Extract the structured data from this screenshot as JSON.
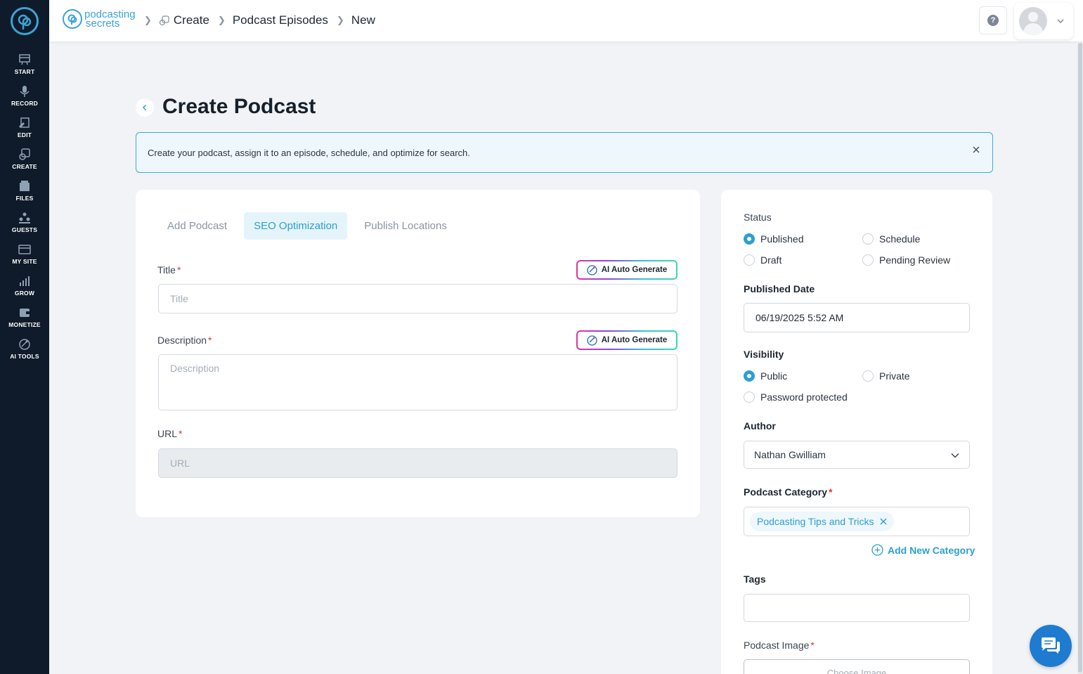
{
  "nav": {
    "items": [
      {
        "label": "START",
        "icon": "start-icon"
      },
      {
        "label": "RECORD",
        "icon": "microphone-icon"
      },
      {
        "label": "EDIT",
        "icon": "edit-icon"
      },
      {
        "label": "CREATE",
        "icon": "create-icon"
      },
      {
        "label": "FILES",
        "icon": "files-icon"
      },
      {
        "label": "GUESTS",
        "icon": "guests-icon"
      },
      {
        "label": "MY SITE",
        "icon": "my-site-icon"
      },
      {
        "label": "GROW",
        "icon": "grow-icon"
      },
      {
        "label": "MONETIZE",
        "icon": "monetize-icon"
      },
      {
        "label": "AI TOOLS",
        "icon": "ai-tools-icon"
      }
    ]
  },
  "header": {
    "brand_line1": "podcasting",
    "brand_line2": "secrets",
    "breadcrumbs": [
      "Create",
      "Podcast Episodes",
      "New"
    ],
    "help_label": "?"
  },
  "page": {
    "title": "Create Podcast",
    "banner": "Create your podcast, assign it to an episode, schedule, and optimize for search."
  },
  "tabs": [
    {
      "label": "Add Podcast",
      "active": false
    },
    {
      "label": "SEO Optimization",
      "active": true
    },
    {
      "label": "Publish Locations",
      "active": false
    }
  ],
  "form": {
    "title_label": "Title",
    "title_placeholder": "Title",
    "description_label": "Description",
    "description_placeholder": "Description",
    "url_label": "URL",
    "url_placeholder": "URL",
    "ai_button_label": "AI Auto Generate",
    "required_mark": "*"
  },
  "sidebar": {
    "status_label": "Status",
    "status_options": [
      {
        "label": "Published",
        "checked": true
      },
      {
        "label": "Schedule",
        "checked": false
      },
      {
        "label": "Draft",
        "checked": false
      },
      {
        "label": "Pending Review",
        "checked": false
      }
    ],
    "published_date_label": "Published Date",
    "published_date_value": "06/19/2025 5:52 AM",
    "visibility_label": "Visibility",
    "visibility_options": [
      {
        "label": "Public",
        "checked": true
      },
      {
        "label": "Private",
        "checked": false
      },
      {
        "label": "Password protected",
        "checked": false
      }
    ],
    "author_label": "Author",
    "author_value": "Nathan Gwilliam",
    "category_label": "Podcast Category",
    "category_chip": "Podcasting Tips and Tricks",
    "add_category_label": "Add New Category",
    "tags_label": "Tags",
    "image_label": "Podcast Image",
    "choose_image_label": "Choose Image"
  },
  "colors": {
    "accent": "#2c9fd3",
    "nav_bg": "#0f1b2b",
    "required": "#e0342c",
    "chat_button": "#1e7bcf"
  }
}
